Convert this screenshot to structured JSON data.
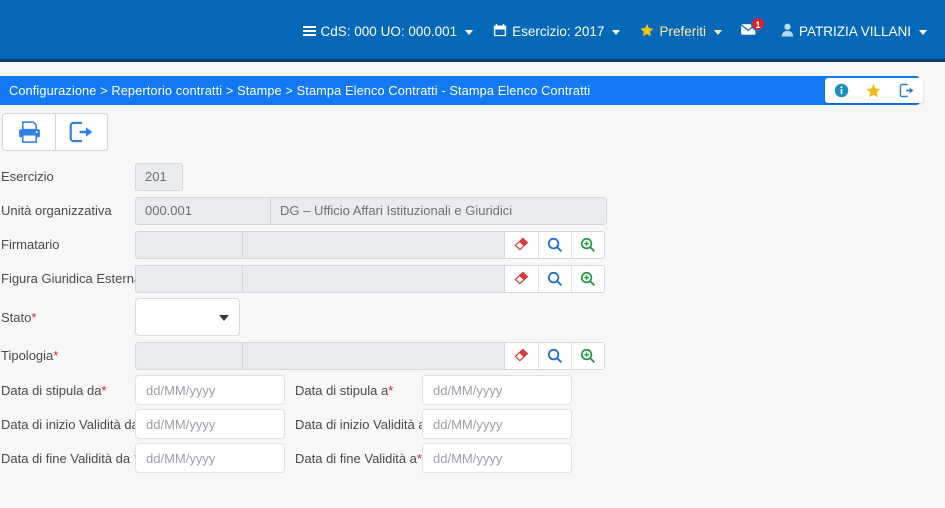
{
  "header": {
    "nav": [
      {
        "name": "cds-uo",
        "label": "CdS: 000 UO: 000.001",
        "icon": "hamburger-icon"
      },
      {
        "name": "esercizio",
        "label": "Esercizio: 2017",
        "icon": "calendar-icon"
      },
      {
        "name": "preferiti",
        "label": "Preferiti",
        "icon": "star-icon"
      },
      {
        "name": "messages",
        "label": "",
        "icon": "envelope-icon",
        "badge": "1"
      },
      {
        "name": "user",
        "label": "PATRIZIA VILLANI",
        "icon": "user-icon"
      }
    ],
    "colors": {
      "header_blue": "#0568b8",
      "breadcrumb_blue": "#1279f2",
      "badge_red": "#d9232d",
      "star_yellow": "#f5c518"
    }
  },
  "breadcrumb": {
    "text": "Configurazione > Repertorio contratti > Stampe > Stampa Elenco Contratti - Stampa Elenco Contratti",
    "actions": [
      {
        "name": "info-icon",
        "label": "info"
      },
      {
        "name": "star-icon",
        "label": "preferito"
      },
      {
        "name": "exit-icon",
        "label": "esci"
      }
    ]
  },
  "toolbar": {
    "buttons": [
      {
        "name": "print-button",
        "icon": "printer-icon",
        "label": "Stampa"
      },
      {
        "name": "export-button",
        "icon": "exit-arrow-icon",
        "label": "Esci"
      }
    ]
  },
  "form": {
    "esercizio": {
      "label": "Esercizio",
      "value": "201"
    },
    "unita_organizzativa": {
      "label": "Unità organizzativa",
      "code": "000.001",
      "description": "DG – Ufficio Affari Istituzionali e Giuridici"
    },
    "firmatario": {
      "label": "Firmatario",
      "required": false,
      "code": "",
      "description": ""
    },
    "figura_giuridica_esterna": {
      "label": "Figura Giuridica Esterna",
      "required": true,
      "code": "",
      "description": ""
    },
    "stato": {
      "label": "Stato",
      "required": true,
      "value": ""
    },
    "tipologia": {
      "label": "Tipologia",
      "required": true,
      "code": "",
      "description": ""
    },
    "lookup_icons": [
      {
        "name": "eraser-icon",
        "label": "Pulisci"
      },
      {
        "name": "search-icon",
        "label": "Cerca"
      },
      {
        "name": "zoom-search-icon",
        "label": "Ricerca avanzata"
      }
    ],
    "dates": [
      {
        "from": {
          "name": "data-stipula-da",
          "label": "Data di stipula da",
          "required": true,
          "value": "",
          "placeholder": "dd/MM/yyyy"
        },
        "to": {
          "name": "data-stipula-a",
          "label": "Data di stipula a",
          "required": true,
          "value": "",
          "placeholder": "dd/MM/yyyy"
        }
      },
      {
        "from": {
          "name": "data-inizio-validita-da",
          "label": "Data di inizio Validità da",
          "required": true,
          "value": "",
          "placeholder": "dd/MM/yyyy"
        },
        "to": {
          "name": "data-inizio-validita-a",
          "label": "Data di inizio Validità a",
          "required": true,
          "value": "",
          "placeholder": "dd/MM/yyyy"
        }
      },
      {
        "from": {
          "name": "data-fine-validita-da",
          "label": "Data di fine Validità da ",
          "required": true,
          "value": "",
          "placeholder": "dd/MM/yyyy"
        },
        "to": {
          "name": "data-fine-validita-a",
          "label": "Data di fine Validità a",
          "required": true,
          "value": "",
          "placeholder": "dd/MM/yyyy"
        }
      }
    ],
    "required_marker": "*"
  }
}
